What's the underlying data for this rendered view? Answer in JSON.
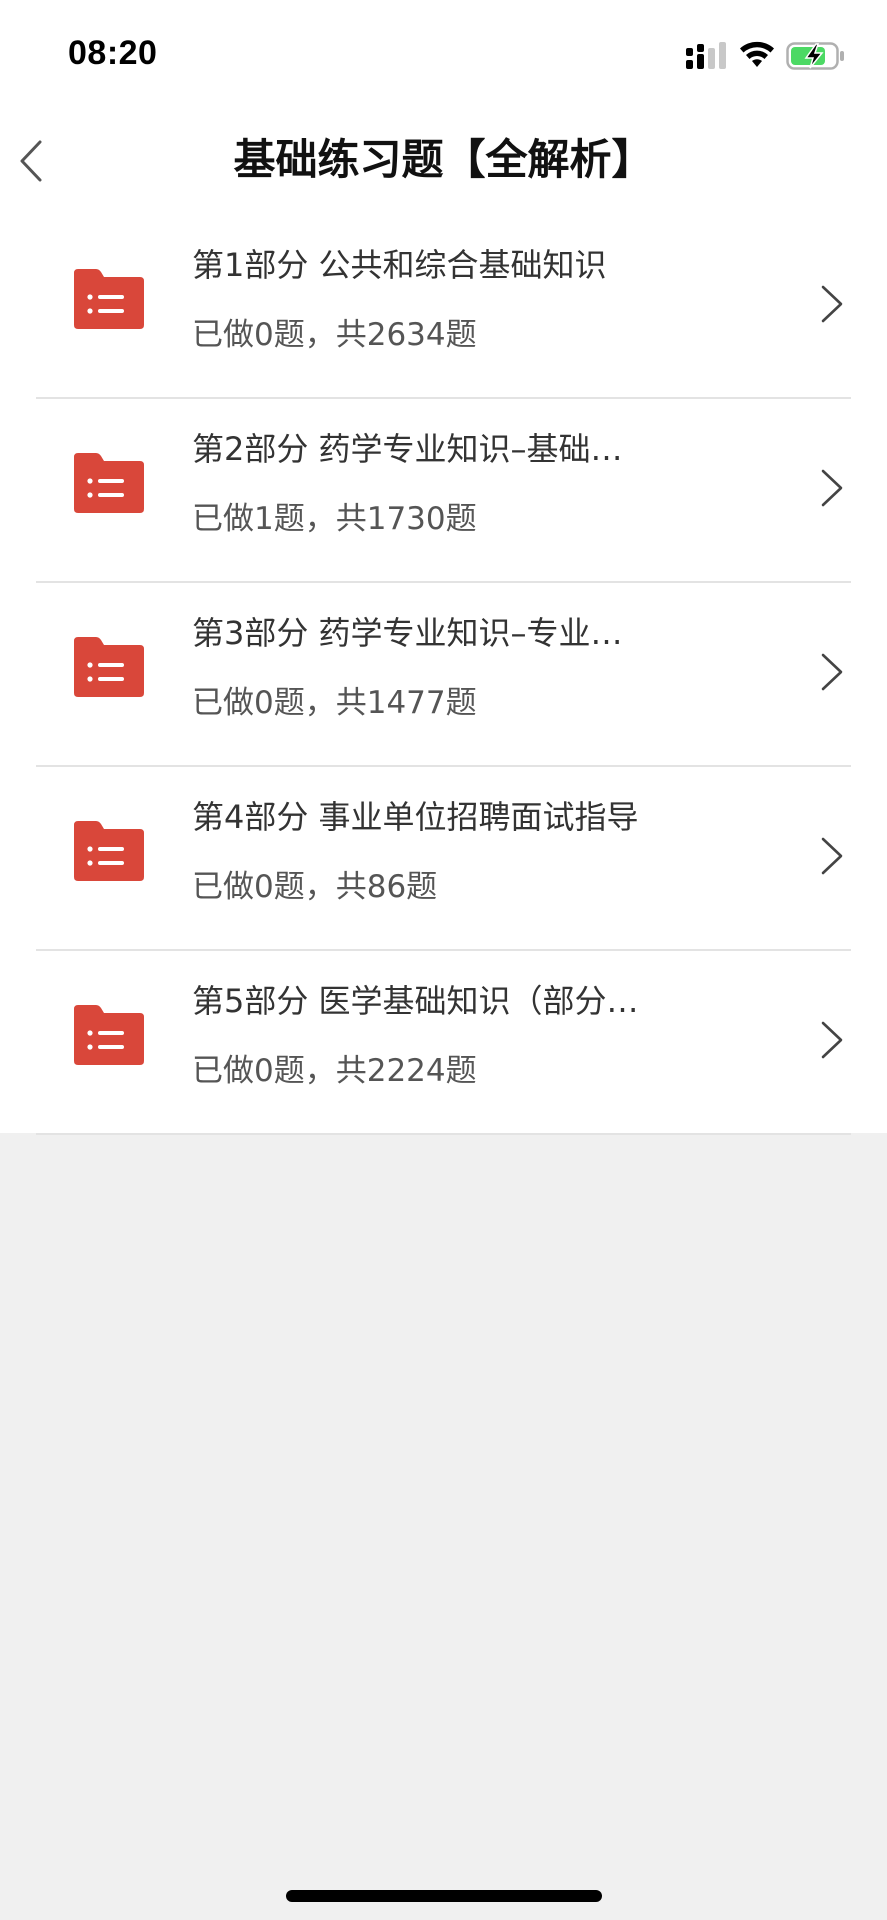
{
  "status_bar": {
    "time": "08:20"
  },
  "nav": {
    "title": "基础练习题【全解析】"
  },
  "colors": {
    "folder_red": "#d9473a",
    "battery_green": "#4cd964",
    "divider": "#e3e3e3",
    "background": "#f0f0f0"
  },
  "icons": {
    "back": "chevron-left-icon",
    "folder": "folder-list-icon",
    "chevron": "chevron-right-icon"
  },
  "items": [
    {
      "title": "第1部分  公共和综合基础知识",
      "progress": "已做0题，共2634题"
    },
    {
      "title": "第2部分  药学专业知识–基础…",
      "progress": "已做1题，共1730题"
    },
    {
      "title": "第3部分  药学专业知识–专业…",
      "progress": "已做0题，共1477题"
    },
    {
      "title": "第4部分  事业单位招聘面试指导",
      "progress": "已做0题，共86题"
    },
    {
      "title": "第5部分  医学基础知识（部分…",
      "progress": "已做0题，共2224题"
    }
  ]
}
